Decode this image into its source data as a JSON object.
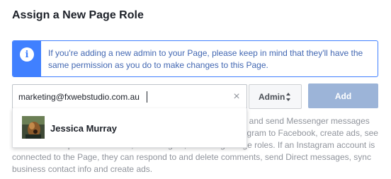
{
  "dialog": {
    "title": "Assign a New Page Role"
  },
  "notice": {
    "icon": "info-icon",
    "icon_glyph": "i",
    "text": "If you're adding a new admin to your Page, please keep in mind that they'll have the same permission as you do to make changes to this Page."
  },
  "form": {
    "email_value": "marketing@fxwebstudio.com.au",
    "clear_icon": "close-icon",
    "clear_glyph": "×",
    "role_selected": "Admin",
    "role_icon": "sort-arrows-icon",
    "add_label": "Add"
  },
  "description": {
    "text": "Admins can manage all aspects of the Page. They can publish and send Messenger messages as the Page, respond to and delete comments, post from Instagram to Facebook, create ads, see who created a post or comment, view insights, and assign Page roles. If an Instagram account is connected to the Page, they can respond to and delete comments, send Direct messages, sync business contact info and create ads."
  },
  "suggestions": [
    {
      "name": "Jessica Murray",
      "avatar": "avatar"
    }
  ],
  "colors": {
    "accent": "#4080ff",
    "info_text": "#4267b2",
    "button_disabled": "#9cb4d8",
    "muted_text": "#90949c"
  }
}
